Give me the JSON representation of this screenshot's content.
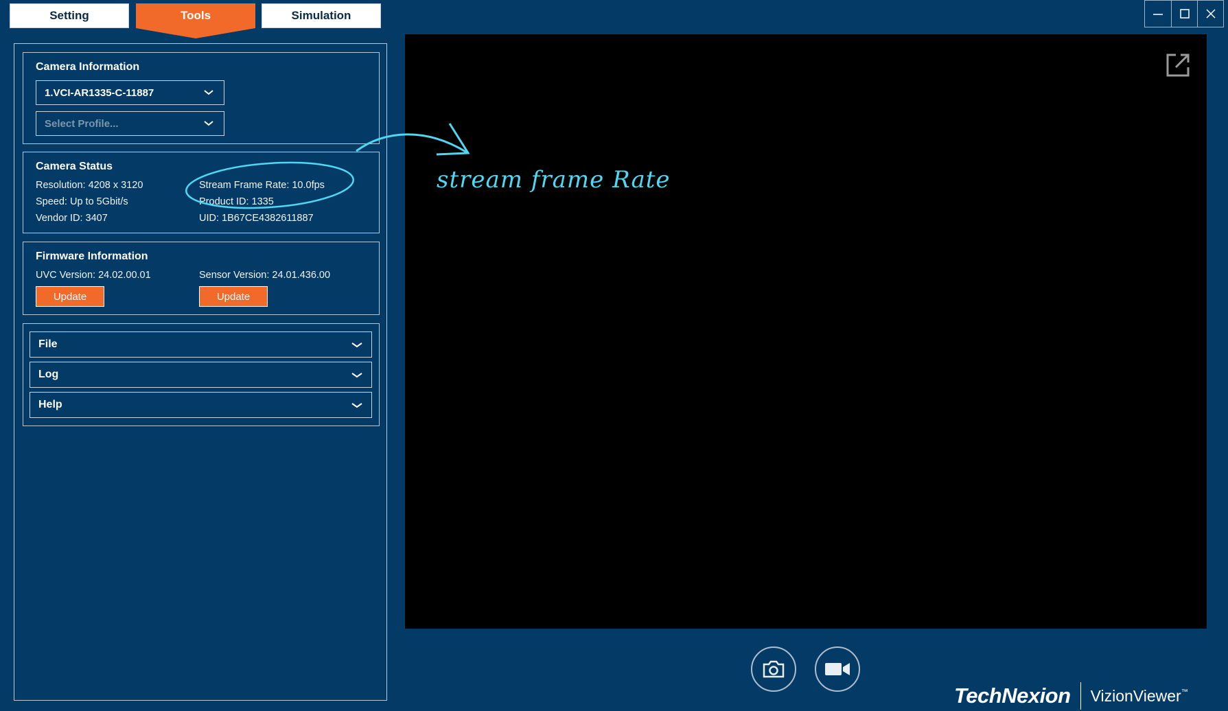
{
  "tabs": {
    "setting": "Setting",
    "tools": "Tools",
    "simulation": "Simulation"
  },
  "window_controls": {
    "minimize": "—",
    "maximize": "☐",
    "close": "✕"
  },
  "camera_information": {
    "title": "Camera Information",
    "device": "1.VCI-AR1335-C-11887",
    "profile_placeholder": "Select Profile..."
  },
  "camera_status": {
    "title": "Camera Status",
    "resolution": "Resolution: 4208 x 3120",
    "speed": "Speed: Up to 5Gbit/s",
    "vendor_id": "Vendor ID: 3407",
    "stream_frame_rate": "Stream Frame Rate: 10.0fps",
    "product_id": "Product ID: 1335",
    "uid": "UID: 1B67CE4382611887"
  },
  "firmware_information": {
    "title": "Firmware Information",
    "uvc_version": "UVC Version: 24.02.00.01",
    "sensor_version": "Sensor Version: 24.01.436.00",
    "uvc_update": "Update",
    "sensor_update": "Update"
  },
  "menu": {
    "file": "File",
    "log": "Log",
    "help": "Help"
  },
  "annotation": {
    "text": "stream frame Rate",
    "color": "#4fd8f2"
  },
  "brand": {
    "company": "TechNexion",
    "product": "VizionViewer",
    "trademark": "™"
  },
  "colors": {
    "background": "#033a66",
    "accent": "#f26a2a",
    "video_bg": "#000000"
  },
  "icons": {
    "popout": "popout-icon",
    "snapshot": "camera-icon",
    "record": "video-camera-icon"
  }
}
